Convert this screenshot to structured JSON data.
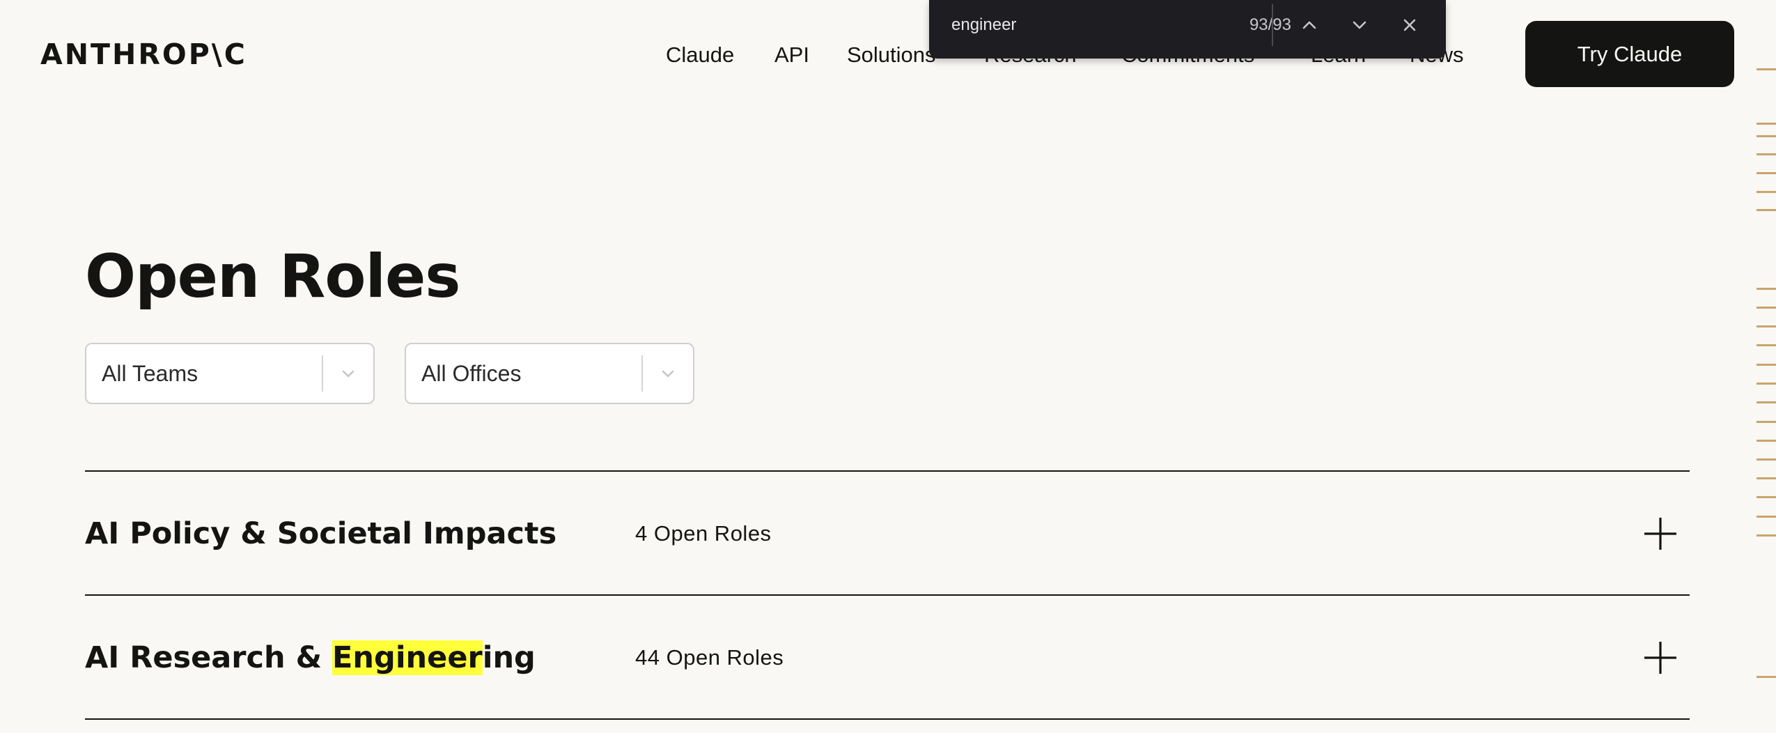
{
  "header": {
    "logo": "ANTHROP\\C",
    "nav": [
      {
        "label": "Claude",
        "name": "nav-claude"
      },
      {
        "label": "API",
        "name": "nav-api"
      },
      {
        "label": "Solutions",
        "name": "nav-solutions"
      },
      {
        "label": "Research",
        "name": "nav-research"
      },
      {
        "label": "Commitments",
        "name": "nav-commitments"
      },
      {
        "label": "Learn",
        "name": "nav-learn"
      },
      {
        "label": "News",
        "name": "nav-news"
      }
    ],
    "cta": "Try Claude"
  },
  "find_bar": {
    "query": "engineer",
    "match_count": "93/93",
    "icons": {
      "prev": "chevron-up-icon",
      "next": "chevron-down-icon",
      "close": "close-icon"
    }
  },
  "main": {
    "title": "Open Roles",
    "filters": [
      {
        "selected": "All Teams"
      },
      {
        "selected": "All Offices"
      }
    ],
    "departments": [
      {
        "before": "AI Policy & Societal Impacts",
        "highlight": "",
        "after": "",
        "count": "4 Open Roles"
      },
      {
        "before": "AI Research & ",
        "highlight": "Engineer",
        "after": "ing",
        "count": "44 Open Roles"
      }
    ]
  },
  "colors": {
    "background": "#f9f8f4",
    "text": "#141413",
    "highlight": "#ffff3a",
    "rail_tick": "#c9a46a",
    "find_bar_bg": "#1e1e22"
  }
}
